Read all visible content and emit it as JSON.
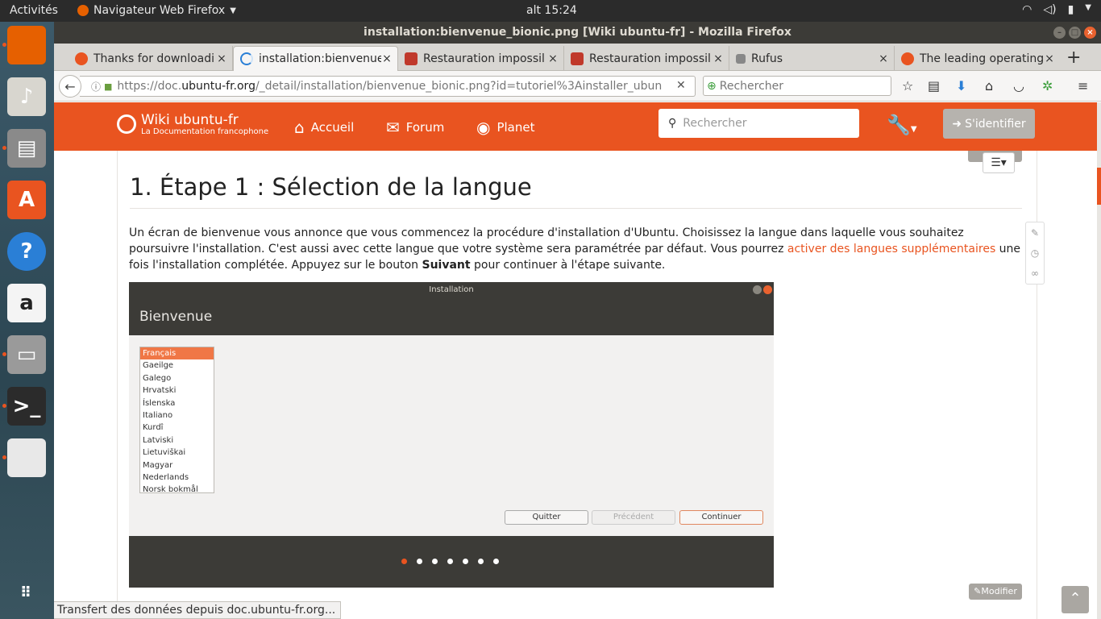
{
  "topbar": {
    "activities": "Activités",
    "app": "Navigateur Web Firefox",
    "clock": "alt 15:24"
  },
  "window": {
    "title": "installation:bienvenue_bionic.png [Wiki ubuntu-fr] - Mozilla Firefox"
  },
  "launcher": {
    "items": [
      {
        "name": "firefox",
        "glyph": "",
        "color": "#e66000"
      },
      {
        "name": "rhythmbox",
        "glyph": "♪",
        "color": "#d8d6cf"
      },
      {
        "name": "files",
        "glyph": "▤",
        "color": "#8a8a8a"
      },
      {
        "name": "software-center",
        "glyph": "A",
        "color": "#e95420"
      },
      {
        "name": "help",
        "glyph": "?",
        "color": "#2a7fd6"
      },
      {
        "name": "amazon",
        "glyph": "a",
        "color": "#f4f4f4"
      },
      {
        "name": "scanner",
        "glyph": "▭",
        "color": "#9a9a9a"
      },
      {
        "name": "terminal",
        "glyph": ">_",
        "color": "#2b2b2b"
      },
      {
        "name": "text-editor",
        "glyph": "",
        "color": "#e8e8e8"
      }
    ]
  },
  "tabs": [
    {
      "label": "Thanks for downloadi",
      "icon": "#e95420"
    },
    {
      "label": "installation:bienvenue",
      "icon": "#2a7fd6"
    },
    {
      "label": "Restauration impossil",
      "icon": "#c0392b"
    },
    {
      "label": "Restauration impossil",
      "icon": "#c0392b"
    },
    {
      "label": "Rufus",
      "icon": "#888888"
    },
    {
      "label": "The leading operating",
      "icon": "#e95420"
    }
  ],
  "navbar": {
    "url_prefix": "https://doc.",
    "url_domain": "ubuntu-fr.org",
    "url_rest": "/_detail/installation/bienvenue_bionic.png?id=tutoriel%3Ainstaller_ubun",
    "search_placeholder": "Rechercher"
  },
  "wiki": {
    "logo_title": "Wiki ubuntu-fr",
    "logo_subtitle": "La Documentation francophone",
    "nav": [
      {
        "label": "Accueil",
        "icon": "⌂"
      },
      {
        "label": "Forum",
        "icon": "✉"
      },
      {
        "label": "Planet",
        "icon": "◉"
      }
    ],
    "search_placeholder": "Rechercher",
    "login": "S'identifier"
  },
  "article": {
    "heading": "1. Étape 1 : Sélection de la langue",
    "para_1": "Un écran de bienvenue vous annonce que vous commencez la procédure d'installation d'Ubuntu. Choisissez la langue dans laquelle vous souhaitez poursuivre l'installation. C'est aussi avec cette langue que votre système sera paramétrée par défaut. Vous pourrez ",
    "para_link": "activer des langues supplémentaires",
    "para_2": " une fois l'installation complétée. Appuyez sur le bouton ",
    "para_bold": "Suivant",
    "para_3": " pour continuer à l'étape suivante.",
    "modifier": "Modifier"
  },
  "installer": {
    "title": "Installation",
    "header": "Bienvenue",
    "languages": [
      "Français",
      "Gaeilge",
      "Galego",
      "Hrvatski",
      "Íslenska",
      "Italiano",
      "Kurdî",
      "Latviski",
      "Lietuviškai",
      "Magyar",
      "Nederlands",
      "Norsk bokmål"
    ],
    "selected_index": 0,
    "buttons": {
      "quit": "Quitter",
      "previous": "Précédent",
      "continue": "Continuer"
    },
    "progress_dots": 7,
    "active_dot": 0
  },
  "status": "Transfert des données depuis doc.ubuntu-fr.org..."
}
